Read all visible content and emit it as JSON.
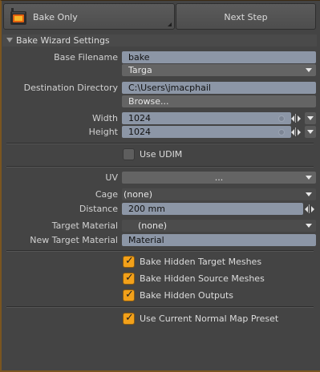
{
  "toolbar": {
    "bake_only": "Bake Only",
    "next_step": "Next Step"
  },
  "section": {
    "title": "Bake Wizard Settings"
  },
  "fields": {
    "base_filename": {
      "label": "Base Filename",
      "value": "bake"
    },
    "format": {
      "value": "Targa"
    },
    "destination": {
      "label": "Destination Directory",
      "value": "C:\\Users\\jmacphail",
      "browse": "Browse..."
    },
    "width": {
      "label": "Width",
      "value": "1024"
    },
    "height": {
      "label": "Height",
      "value": "1024"
    },
    "use_udim": {
      "label": "Use UDIM",
      "checked": false
    },
    "uv": {
      "label": "UV",
      "value": "..."
    },
    "cage": {
      "label": "Cage",
      "value": "(none)"
    },
    "distance": {
      "label": "Distance",
      "value": "200 mm"
    },
    "target_material": {
      "label": "Target Material",
      "value": "(none)"
    },
    "new_target_material": {
      "label": "New Target Material",
      "value": "Material"
    }
  },
  "checkboxes": [
    {
      "label": "Bake Hidden Target Meshes",
      "checked": true
    },
    {
      "label": "Bake Hidden Source Meshes",
      "checked": true
    },
    {
      "label": "Bake Hidden Outputs",
      "checked": true
    },
    {
      "label": "Use Current Normal Map Preset",
      "checked": true
    }
  ],
  "colors": {
    "field": "#8c96a6",
    "checkbox_on": "#f3a11a",
    "background": "#444444"
  }
}
